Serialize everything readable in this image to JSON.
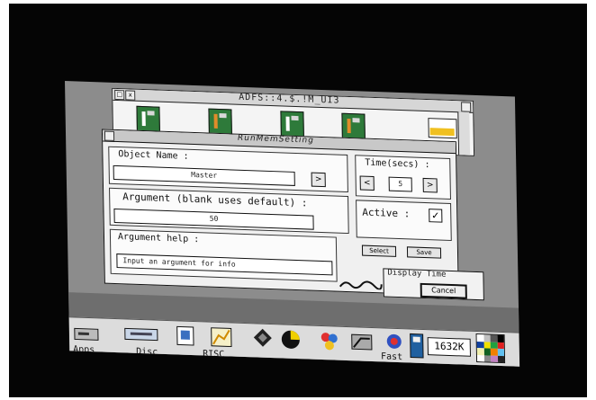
{
  "filer": {
    "title": "ADFS::4.$.!M_UI3",
    "close_label": "x",
    "back_label": "□"
  },
  "dialog": {
    "title": "RunMemSetting",
    "argument_label": "Argument (blank uses default) :",
    "argument_value": "50",
    "object_label": "Object Name :",
    "object_value": "Master",
    "time_label": "Time(secs) :",
    "time_value": "5",
    "active_label": "Active :",
    "active_check": "✓",
    "argument_help_label": "Argument help :",
    "help_field_value": "Input an argument for info",
    "select_label": "Select",
    "save_label": "Save",
    "arrow_left": "<",
    "arrow_right": ">"
  },
  "info_box": {
    "title": "Display Time",
    "button_label": "Cancel"
  },
  "iconbar": {
    "fast_label": "Fast",
    "memory": "1632K",
    "item_labels": [
      "Apps",
      "Disc",
      "RISC"
    ]
  },
  "colors": {
    "filer_icon_green": "#2e7a3a",
    "folder_yellow": "#f0c020",
    "desktop_grey": "#8c8c8c"
  },
  "icons": [
    "harddisc-icon",
    "printer-icon",
    "paint-icon",
    "chart-icon",
    "diamond-icon",
    "pie-icon",
    "riscos-logo-icon",
    "task-manager-icon",
    "fast-icon",
    "display-icon",
    "palette-icon"
  ]
}
